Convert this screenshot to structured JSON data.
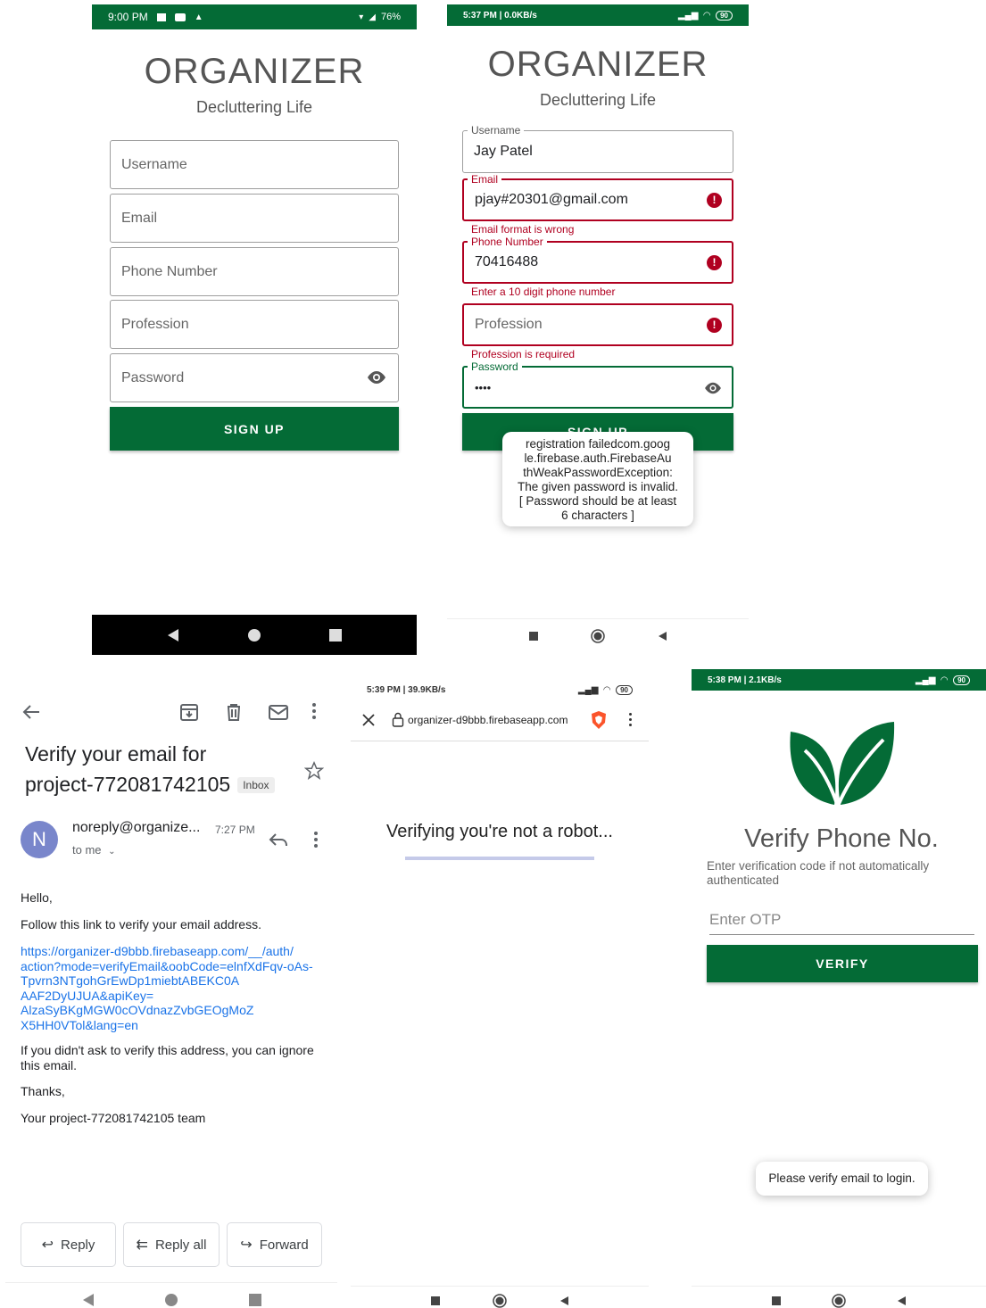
{
  "colors": {
    "brand_green": "#046b36",
    "error_red": "#b00020",
    "link_blue": "#1a73e8"
  },
  "panel1": {
    "status": {
      "time": "9:00 PM",
      "battery": "76%"
    },
    "title": "ORGANIZER",
    "subtitle": "Decluttering Life",
    "fields": {
      "username": "Username",
      "email": "Email",
      "phone": "Phone Number",
      "profession": "Profession",
      "password": "Password"
    },
    "signup_label": "SIGN UP"
  },
  "panel2": {
    "status": {
      "time": "5:37 PM | 0.0KB/s",
      "battery": "90"
    },
    "title": "ORGANIZER",
    "subtitle": "Decluttering Life",
    "username": {
      "label": "Username",
      "value": "Jay Patel"
    },
    "email": {
      "label": "Email",
      "value": "pjay#20301@gmail.com",
      "error": "Email format is wrong"
    },
    "phone": {
      "label": "Phone Number",
      "value": "70416488",
      "error": "Enter a 10 digit phone number"
    },
    "profession": {
      "placeholder": "Profession",
      "error": "Profession is required"
    },
    "password": {
      "label": "Password",
      "value": "••••"
    },
    "signup_label": "SIGN UP",
    "toast_lines": [
      "registration failedcom.goog",
      "le.firebase.auth.FirebaseAu",
      "thWeakPasswordException:",
      "The given password is invalid.",
      "[ Password should be at least",
      "6 characters ]"
    ]
  },
  "panel3": {
    "subject_line1": "Verify your email for",
    "subject_line2": "project-772081742105",
    "inbox_badge": "Inbox",
    "avatar_letter": "N",
    "sender": "noreply@organize...",
    "time": "7:27 PM",
    "to": "to me",
    "greeting": "Hello,",
    "body1": "Follow this link to verify your email address.",
    "link_lines": [
      "https://organizer-d9bbb.firebaseapp.com/__/auth/",
      "action?mode=verifyEmail&oobCode=elnfXdFqv-oAs-",
      "Tpvrn3NTgohGrEwDp1miebtABEKC0A",
      "AAF2DyUJUA&apiKey=",
      "AlzaSyBKgMGW0cOVdnazZvbGEOgMoZ",
      "X5HH0VTol&lang=en"
    ],
    "ignore_line1": "If you didn't ask to verify this address, you can ignore",
    "ignore_line2": "this email.",
    "thanks": "Thanks,",
    "signoff": "Your project-772081742105 team",
    "reply_label": "Reply",
    "reply_all_label": "Reply all",
    "forward_label": "Forward"
  },
  "panel4": {
    "status": {
      "time": "5:39 PM | 39.9KB/s",
      "battery": "90"
    },
    "url": "organizer-d9bbb.firebaseapp.com",
    "message": "Verifying you're not a robot..."
  },
  "panel5": {
    "status": {
      "time": "5:38 PM | 2.1KB/s",
      "battery": "90"
    },
    "title": "Verify Phone No.",
    "desc_line1": "Enter verification code if not automatically",
    "desc_line2": "authenticated",
    "otp_placeholder": "Enter OTP",
    "verify_label": "VERIFY",
    "toast": "Please verify email to login."
  }
}
